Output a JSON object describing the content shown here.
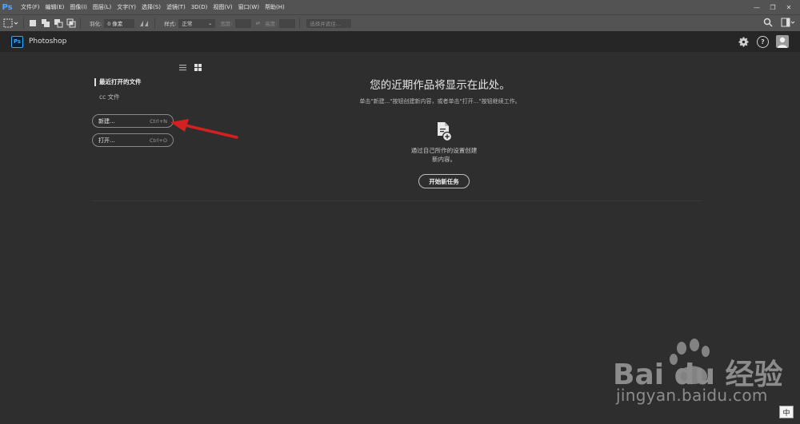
{
  "menubar": {
    "logo": "Ps",
    "items": [
      "文件(F)",
      "编辑(E)",
      "图像(I)",
      "图层(L)",
      "文字(Y)",
      "选择(S)",
      "滤镜(T)",
      "3D(D)",
      "视图(V)",
      "窗口(W)",
      "帮助(H)"
    ],
    "window_controls": [
      "—",
      "❐",
      "✕"
    ]
  },
  "optbar": {
    "feather_label": "羽化:",
    "feather_value": "0 像素",
    "style_label": "样式:",
    "style_value": "正常",
    "width_label": "宽度:",
    "height_label": "高度:",
    "select_mask_label": "选择并遮住..."
  },
  "header": {
    "badge": "Ps",
    "title": "Photoshop"
  },
  "left": {
    "recent_title": "最近打开的文件",
    "cc_files": "cc 文件",
    "new_label": "新建...",
    "new_shortcut": "Ctrl+N",
    "open_label": "打开...",
    "open_shortcut": "Ctrl+O"
  },
  "center": {
    "title": "您的近期作品将显示在此处。",
    "subtitle": "单击\"新建...\"按钮创建新内容，或者单击\"打开...\"按钮继续工作。",
    "newdoc_line1": "通过自己所作的设置创建",
    "newdoc_line2": "新内容。",
    "start_button": "开始新任务"
  },
  "watermark": {
    "text": "Bai du 经验",
    "url": "jingyan.baidu.com"
  },
  "ime": "中",
  "colors": {
    "accent": "#31a8ff",
    "arrow": "#d42020",
    "background": "#2e2e2e"
  }
}
